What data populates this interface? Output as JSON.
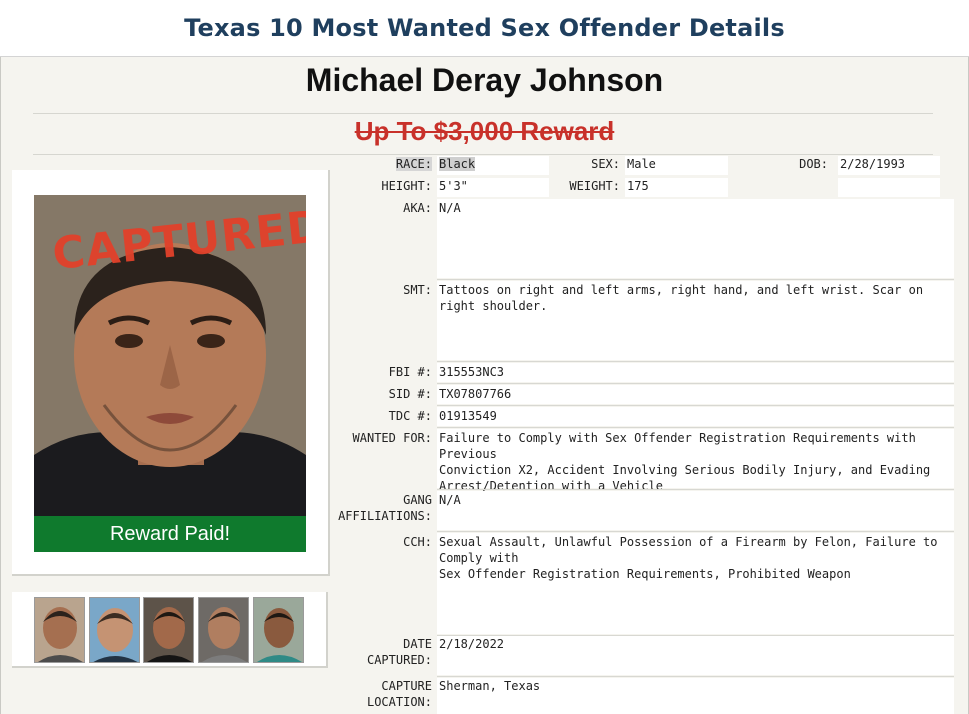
{
  "header": {
    "title": "Texas 10 Most Wanted Sex Offender Details"
  },
  "offender": {
    "name": "Michael Deray Johnson",
    "reward": "Up To $3,000 Reward",
    "stamp": "CAPTURED",
    "reward_status": "Reward Paid!"
  },
  "details": {
    "race_label": "RACE:",
    "race": "Black",
    "sex_label": "SEX:",
    "sex": "Male",
    "dob_label": "DOB:",
    "dob": "2/28/1993",
    "height_label": "HEIGHT:",
    "height": "5'3\"",
    "weight_label": "WEIGHT:",
    "weight": "175",
    "aka_label": "AKA:",
    "aka": "N/A",
    "smt_label": "SMT:",
    "smt": "Tattoos on right and left arms, right hand, and left wrist. Scar on right shoulder.",
    "fbi_label": "FBI #:",
    "fbi": "315553NC3",
    "sid_label": "SID #:",
    "sid": "TX07807766",
    "tdc_label": "TDC #:",
    "tdc": "01913549",
    "wanted_label": "WANTED FOR:",
    "wanted_1": "Failure to Comply with Sex Offender Registration Requirements with Previous",
    "wanted_2": "Conviction X2, Accident Involving Serious Bodily Injury, and Evading",
    "wanted_3": "Arrest/Detention with a Vehicle",
    "gang_label_1": "GANG",
    "gang_label_2": "AFFILIATIONS:",
    "gang": "N/A",
    "cch_label": "CCH:",
    "cch_1": "Sexual Assault, Unlawful Possession of a Firearm by Felon, Failure to Comply with",
    "cch_2": "Sex Offender Registration Requirements, Prohibited Weapon",
    "date_label_1": "DATE",
    "date_label_2": "CAPTURED:",
    "date_captured": "2/18/2022",
    "loc_label_1": "CAPTURE",
    "loc_label_2": "LOCATION:",
    "capture_location": "Sherman, Texas"
  },
  "colors": {
    "title": "#1f3f5e",
    "reward": "#c8312a",
    "reward_paid_bg": "#0f7a2d",
    "stamp": "#e2412a",
    "panel_bg": "#f5f4ef"
  },
  "thumbnails": [
    {
      "name": "thumbnail-photo-1",
      "bg": "#b9a48e"
    },
    {
      "name": "thumbnail-photo-2",
      "bg": "#7aa7c8"
    },
    {
      "name": "thumbnail-photo-3",
      "bg": "#5d5349"
    },
    {
      "name": "thumbnail-photo-4",
      "bg": "#6e6a66"
    },
    {
      "name": "thumbnail-photo-5",
      "bg": "#9aa89a"
    }
  ]
}
